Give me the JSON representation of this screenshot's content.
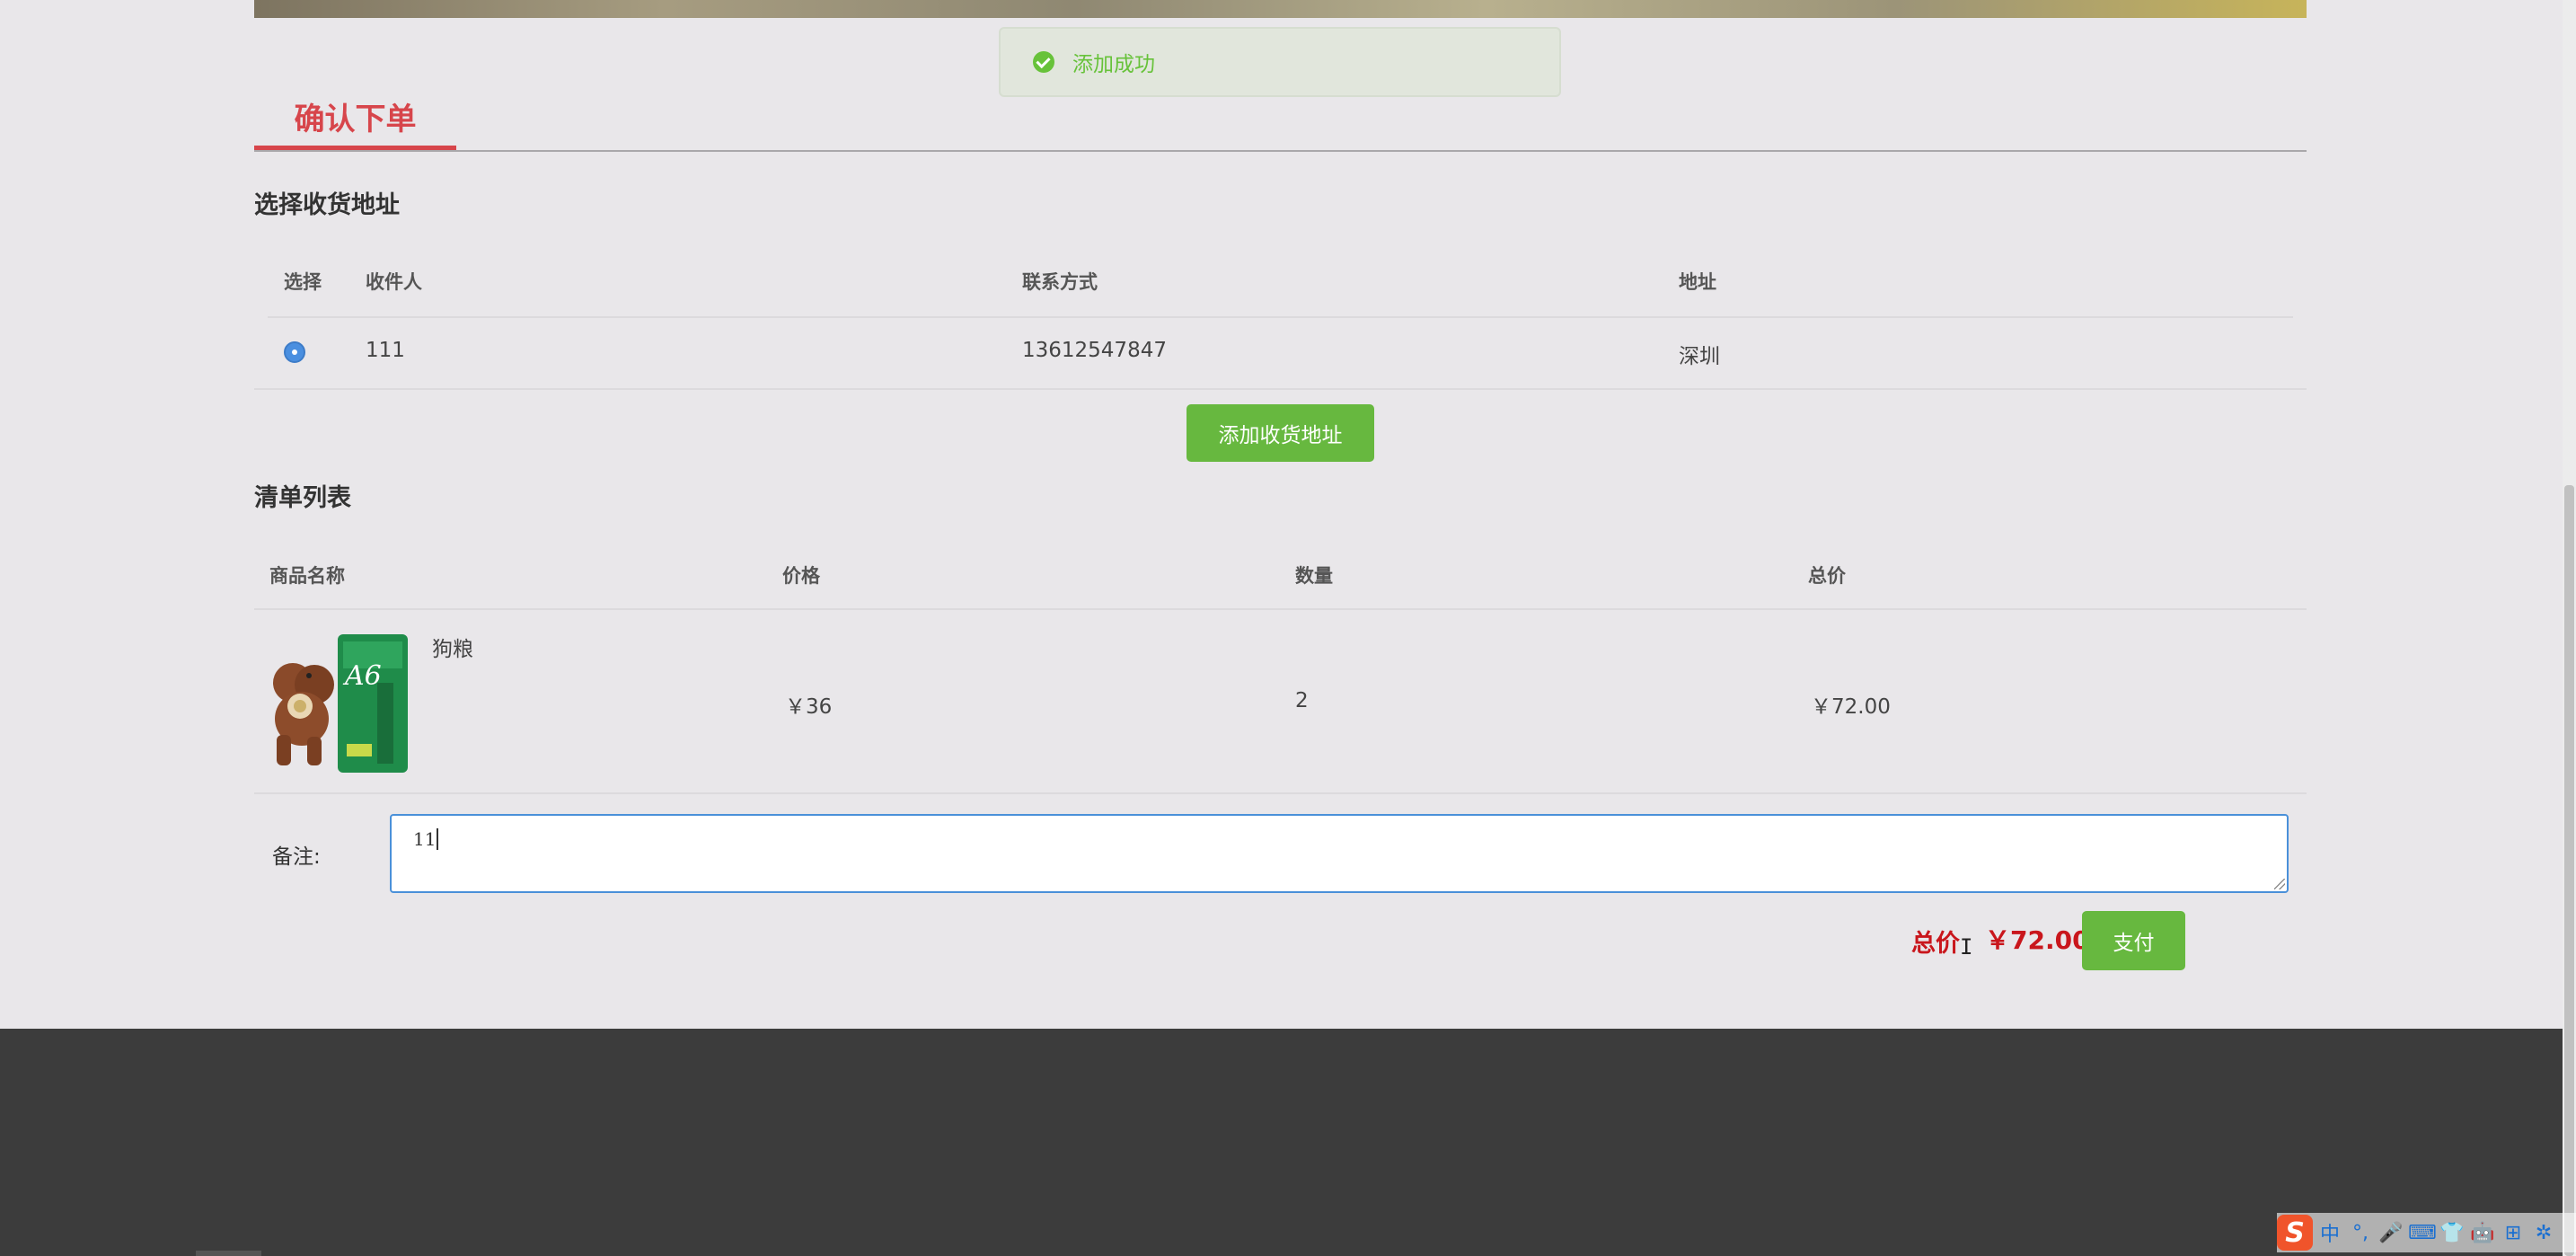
{
  "toast": {
    "message": "添加成功",
    "icon": "check-circle-icon",
    "color": "#67c23a"
  },
  "page": {
    "title": "确认下单",
    "accent": "#d7454b"
  },
  "address_section": {
    "heading": "选择收货地址",
    "columns": [
      "选择",
      "收件人",
      "联系方式",
      "地址"
    ],
    "rows": [
      {
        "selected": true,
        "recipient": "111",
        "phone": "13612547847",
        "address": "深圳"
      }
    ],
    "add_button": "添加收货地址"
  },
  "order_section": {
    "heading": "清单列表",
    "columns": [
      "商品名称",
      "价格",
      "数量",
      "总价"
    ],
    "items": [
      {
        "name": "狗粮",
        "price": "￥36",
        "quantity": "2",
        "subtotal": "￥72.00",
        "image": "dog-food-product-image"
      }
    ]
  },
  "remark": {
    "label": "备注:",
    "value": "11"
  },
  "summary": {
    "total_label": "总价",
    "total_value": "￥72.00",
    "pay_button": "支付",
    "total_color": "#c9161c"
  },
  "ime": {
    "logo": "S",
    "items": [
      "中",
      "°,",
      "🎤",
      "⌨",
      "👕",
      "🤖",
      "⊞",
      "✲"
    ]
  }
}
